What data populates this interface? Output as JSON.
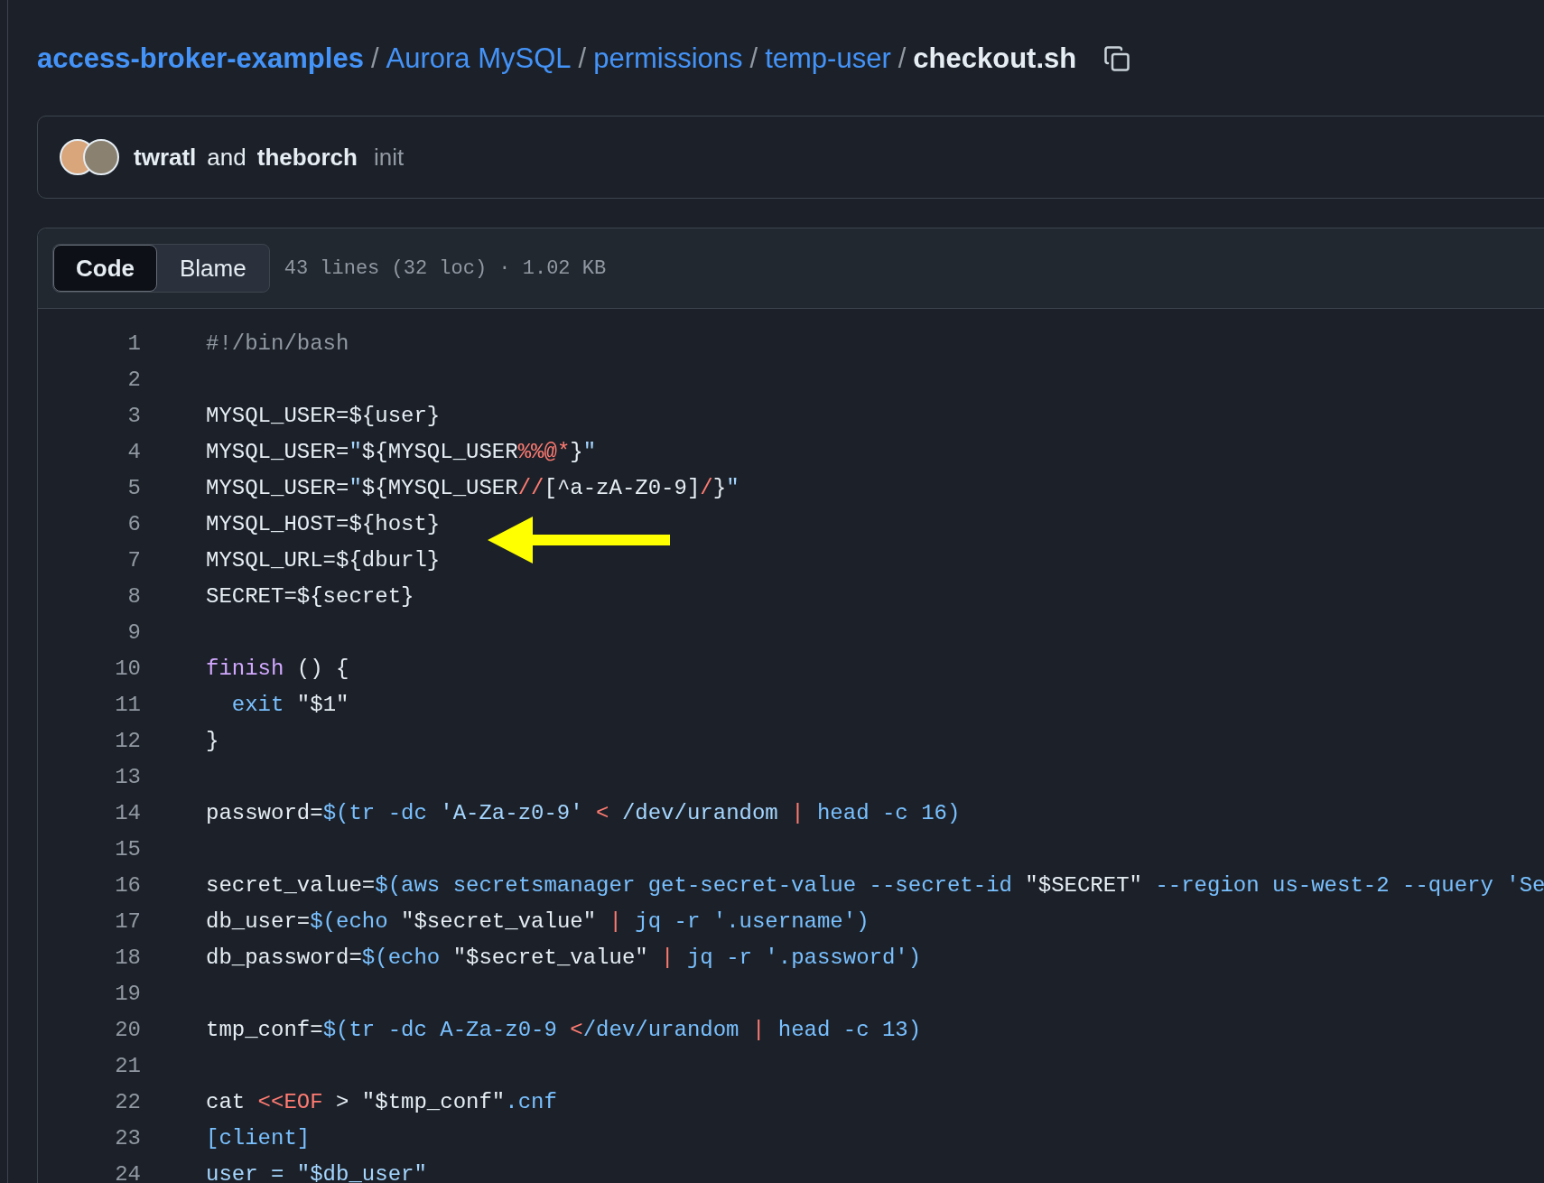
{
  "breadcrumb": {
    "links": [
      "access-broker-examples",
      "Aurora MySQL",
      "permissions",
      "temp-user"
    ],
    "separator": "/",
    "current": "checkout.sh"
  },
  "commit": {
    "author_1": "twratl",
    "joiner": "and",
    "author_2": "theborch",
    "message": "init"
  },
  "file_view": {
    "tabs": [
      {
        "label": "Code",
        "selected": true
      },
      {
        "label": "Blame",
        "selected": false
      }
    ],
    "info": "43 lines (32 loc) · 1.02 KB"
  },
  "code_lines": [
    {
      "number": "1",
      "tokens": [
        {
          "text": "#!/bin/bash",
          "kind": "comment"
        }
      ]
    },
    {
      "number": "2"
    },
    {
      "number": "3",
      "tokens": [
        {
          "text": "MYSQL_USER=${user}",
          "kind": "plain"
        }
      ]
    },
    {
      "number": "4",
      "tokens": [
        {
          "text": "MYSQL_USER=",
          "kind": "plain"
        },
        {
          "text": "\"",
          "kind": "string"
        },
        {
          "text": "${MYSQL_USER",
          "kind": "plain"
        },
        {
          "text": "%%@*",
          "kind": "keyword"
        },
        {
          "text": "}",
          "kind": "plain"
        },
        {
          "text": "\"",
          "kind": "string"
        }
      ]
    },
    {
      "number": "5",
      "tokens": [
        {
          "text": "MYSQL_USER=",
          "kind": "plain"
        },
        {
          "text": "\"",
          "kind": "string"
        },
        {
          "text": "${MYSQL_USER",
          "kind": "plain"
        },
        {
          "text": "//",
          "kind": "keyword"
        },
        {
          "text": "[^a-zA-Z0-9]",
          "kind": "plain"
        },
        {
          "text": "/",
          "kind": "keyword"
        },
        {
          "text": "}",
          "kind": "plain"
        },
        {
          "text": "\"",
          "kind": "string"
        }
      ]
    },
    {
      "number": "6",
      "tokens": [
        {
          "text": "MYSQL_HOST=${host}",
          "kind": "plain"
        }
      ]
    },
    {
      "number": "7",
      "tokens": [
        {
          "text": "MYSQL_URL=${dburl}",
          "kind": "plain"
        }
      ]
    },
    {
      "number": "8",
      "tokens": [
        {
          "text": "SECRET=${secret}",
          "kind": "plain"
        }
      ]
    },
    {
      "number": "9"
    },
    {
      "number": "10",
      "tokens": [
        {
          "text": "finish",
          "kind": "function"
        },
        {
          "text": " () {",
          "kind": "plain"
        }
      ]
    },
    {
      "number": "11",
      "tokens": [
        {
          "text": "  exit",
          "kind": "constant"
        },
        {
          "text": " \"$1\"",
          "kind": "plain"
        }
      ]
    },
    {
      "number": "12",
      "tokens": [
        {
          "text": "}",
          "kind": "plain"
        }
      ]
    },
    {
      "number": "13"
    },
    {
      "number": "14",
      "tokens": [
        {
          "text": "password=",
          "kind": "plain"
        },
        {
          "text": "$(tr -dc ",
          "kind": "constant"
        },
        {
          "text": "'A-Za-z0-9'",
          "kind": "string"
        },
        {
          "text": " < ",
          "kind": "keyword"
        },
        {
          "text": "/dev/urandom",
          "kind": "string"
        },
        {
          "text": " | ",
          "kind": "keyword"
        },
        {
          "text": "head -c 16)",
          "kind": "constant"
        }
      ]
    },
    {
      "number": "15"
    },
    {
      "number": "16",
      "tokens": [
        {
          "text": "secret_value=",
          "kind": "plain"
        },
        {
          "text": "$(aws secretsmanager get-secret-value --secret-id ",
          "kind": "constant"
        },
        {
          "text": "\"$SECRET\"",
          "kind": "plain"
        },
        {
          "text": " --region us-west-2 --query 'Se",
          "kind": "constant"
        }
      ]
    },
    {
      "number": "17",
      "tokens": [
        {
          "text": "db_user=",
          "kind": "plain"
        },
        {
          "text": "$(echo ",
          "kind": "constant"
        },
        {
          "text": "\"$secret_value\"",
          "kind": "plain"
        },
        {
          "text": " | ",
          "kind": "keyword"
        },
        {
          "text": "jq -r '.username')",
          "kind": "constant"
        }
      ]
    },
    {
      "number": "18",
      "tokens": [
        {
          "text": "db_password=",
          "kind": "plain"
        },
        {
          "text": "$(echo ",
          "kind": "constant"
        },
        {
          "text": "\"$secret_value\"",
          "kind": "plain"
        },
        {
          "text": " | ",
          "kind": "keyword"
        },
        {
          "text": "jq -r '.password')",
          "kind": "constant"
        }
      ]
    },
    {
      "number": "19"
    },
    {
      "number": "20",
      "tokens": [
        {
          "text": "tmp_conf=",
          "kind": "plain"
        },
        {
          "text": "$(tr -dc A-Za-z0-9 ",
          "kind": "constant"
        },
        {
          "text": "<",
          "kind": "keyword"
        },
        {
          "text": "/dev/urandom",
          "kind": "constant"
        },
        {
          "text": " | ",
          "kind": "keyword"
        },
        {
          "text": "head -c 13)",
          "kind": "constant"
        }
      ]
    },
    {
      "number": "21"
    },
    {
      "number": "22",
      "tokens": [
        {
          "text": "cat ",
          "kind": "plain"
        },
        {
          "text": "<<EOF",
          "kind": "keyword"
        },
        {
          "text": " > \"$tmp_conf\"",
          "kind": "plain"
        },
        {
          "text": ".cnf",
          "kind": "constant"
        }
      ]
    },
    {
      "number": "23",
      "tokens": [
        {
          "text": "[client]",
          "kind": "constant"
        }
      ]
    },
    {
      "number": "24",
      "tokens": [
        {
          "text": "user = \"$db_user\"",
          "kind": "string"
        }
      ]
    }
  ]
}
